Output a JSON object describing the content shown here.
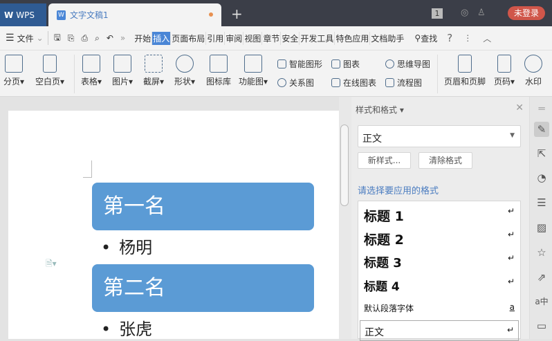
{
  "titlebar": {
    "app": "WPS",
    "doc_tab": "文字文稿1",
    "new_tab": "+",
    "page_count": "1",
    "login": "未登录"
  },
  "menubar": {
    "file": "文件",
    "items": [
      "开始",
      "插入",
      "页面布局",
      "引用",
      "审阅",
      "视图",
      "章节",
      "安全",
      "开发工具",
      "特色应用",
      "文档助手"
    ],
    "active": "插入",
    "find": "查找",
    "help": "?",
    "more": "⋮",
    "collapse": "︿"
  },
  "ribbon": {
    "page_break": "分页",
    "blank_page": "空白页",
    "table": "表格",
    "picture": "图片",
    "screenshot": "截屏",
    "shape": "形状",
    "icon_lib": "图标库",
    "function_chart": "功能图",
    "smart_art": "智能图形",
    "chart": "图表",
    "mind_map": "思维导图",
    "relation": "关系图",
    "online_chart": "在线图表",
    "flowchart": "流程图",
    "header_footer": "页眉和页脚",
    "page_number": "页码",
    "watermark": "水印"
  },
  "document": {
    "headings": [
      "第一名",
      "第二名"
    ],
    "bullets": [
      "杨明",
      "张虎"
    ]
  },
  "panel": {
    "title": "样式和格式",
    "current_style": "正文",
    "new_style": "新样式...",
    "clear_format": "清除格式",
    "prompt": "请选择要应用的格式",
    "styles": [
      {
        "name": "标题 1",
        "mark": "↵"
      },
      {
        "name": "标题 2",
        "mark": "↵"
      },
      {
        "name": "标题 3",
        "mark": "↵"
      },
      {
        "name": "标题 4",
        "mark": "↵"
      },
      {
        "name": "默认段落字体",
        "mark": "a"
      },
      {
        "name": "正文",
        "mark": "↵"
      }
    ]
  },
  "colors": {
    "accent": "#4a86d6",
    "heading_box": "#5b9bd5",
    "login": "#d0564a"
  }
}
